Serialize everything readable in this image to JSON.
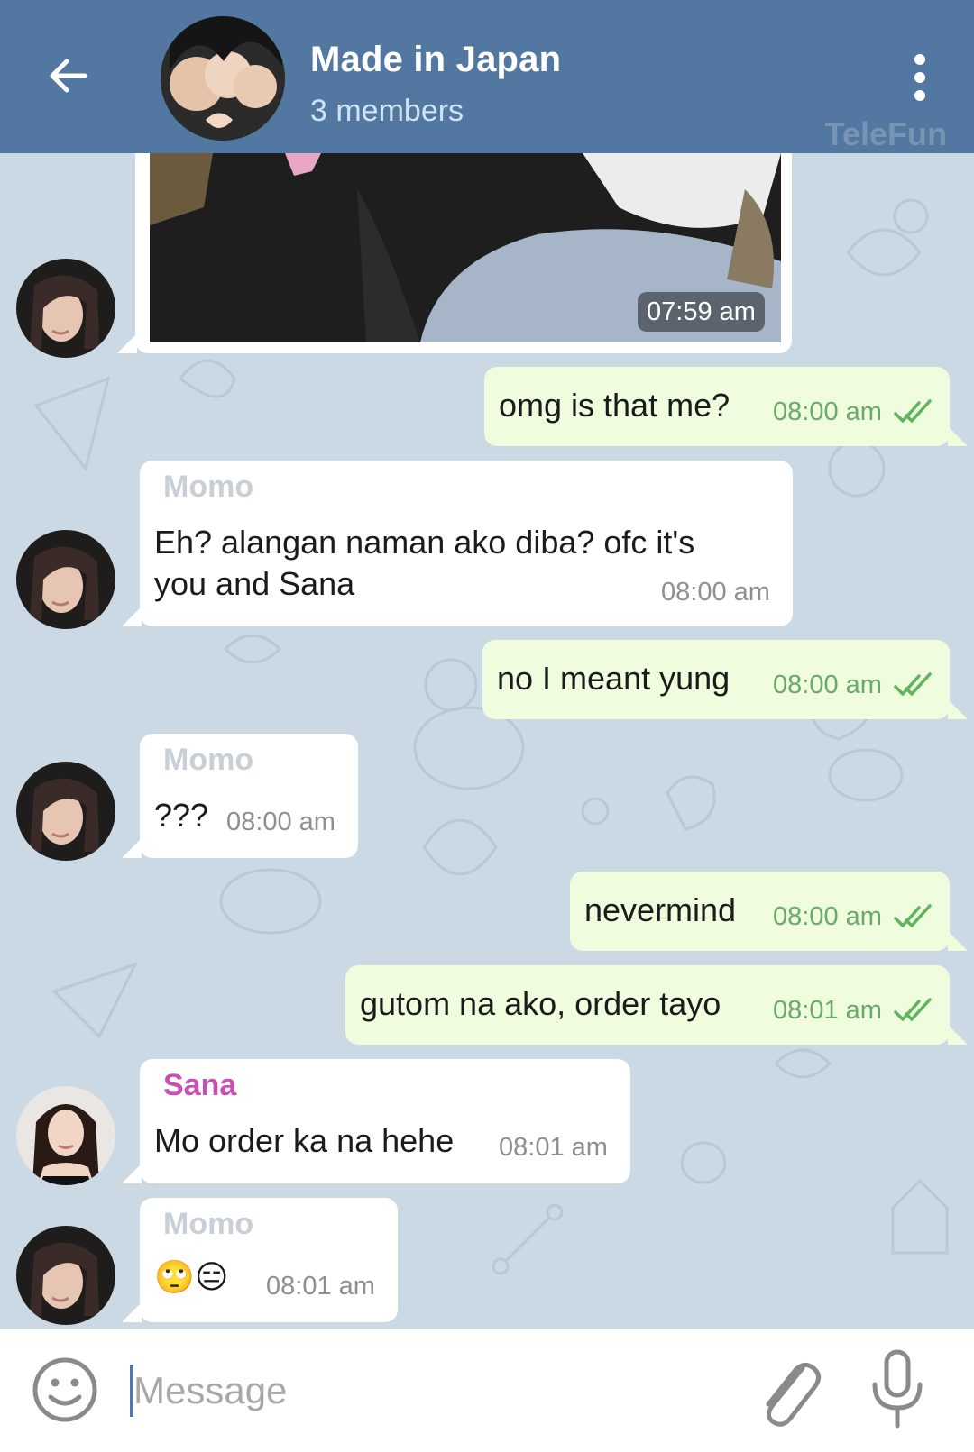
{
  "header": {
    "title": "Made in Japan",
    "subtitle": "3 members",
    "watermark": "TeleFun"
  },
  "photo_message": {
    "time": "07:59 am"
  },
  "messages": [
    {
      "direction": "out",
      "text": "omg is that me?",
      "time": "08:00 am",
      "read": true
    },
    {
      "direction": "in",
      "sender": "Momo",
      "sender_color": "#c9cfd6",
      "text_line1": "Eh? alangan naman ako diba? ofc it's",
      "text_line2": "you and Sana",
      "time": "08:00 am"
    },
    {
      "direction": "out",
      "text": "no I meant yung",
      "time": "08:00 am",
      "read": true
    },
    {
      "direction": "in",
      "sender": "Momo",
      "sender_color": "#c9cfd6",
      "text": "???",
      "time": "08:00 am"
    },
    {
      "direction": "out",
      "text": "nevermind",
      "time": "08:00 am",
      "read": true
    },
    {
      "direction": "out",
      "text": "gutom na ako, order tayo",
      "time": "08:01 am",
      "read": true
    },
    {
      "direction": "in",
      "sender": "Sana",
      "sender_color": "#c94fb5",
      "text": "Mo order ka na hehe",
      "time": "08:01 am"
    },
    {
      "direction": "in",
      "sender": "Momo",
      "sender_color": "#c9cfd6",
      "text": "🙄😑",
      "time": "08:01 am"
    }
  ],
  "input": {
    "placeholder": "Message"
  },
  "colors": {
    "header": "#5277a0",
    "outgoing_bubble": "#effdde",
    "incoming_bubble": "#ffffff",
    "check": "#5eb55e"
  }
}
